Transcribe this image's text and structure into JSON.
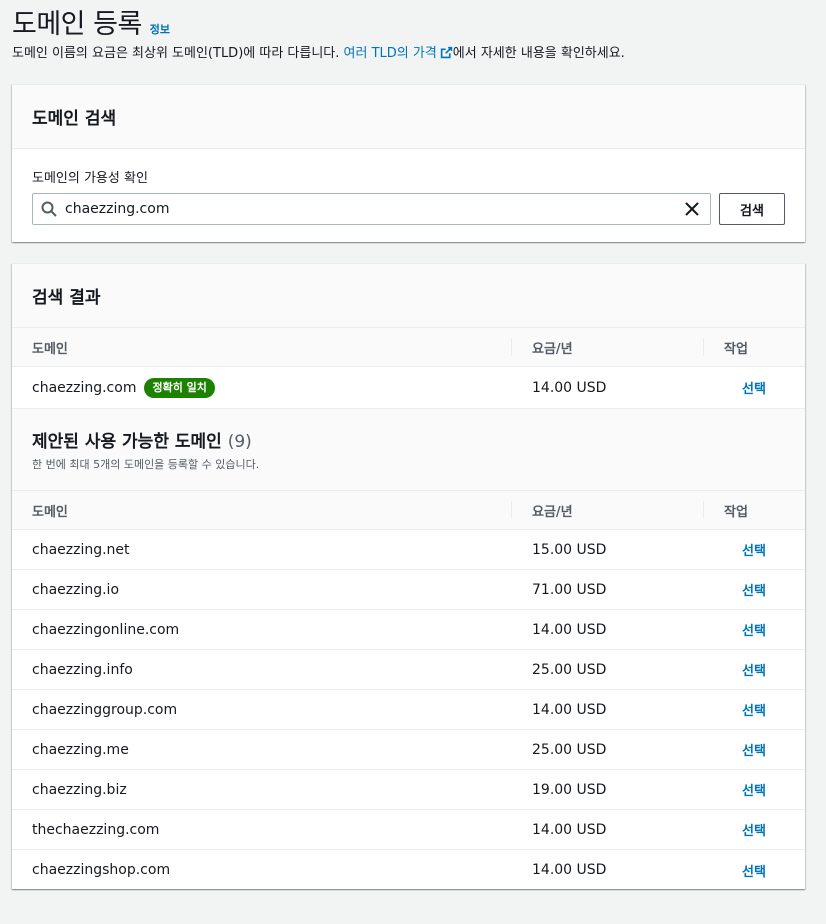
{
  "header": {
    "title": "도메인 등록",
    "info": "정보",
    "desc_prefix": "도메인 이름의 요금은 최상위 도메인(TLD)에 따라 다릅니다. ",
    "desc_link": "여러 TLD의 가격",
    "desc_suffix": "에서 자세한 내용을 확인하세요."
  },
  "search": {
    "title": "도메인 검색",
    "label": "도메인의 가용성 확인",
    "value": "chaezzing.com",
    "button": "검색"
  },
  "results": {
    "title": "검색 결과",
    "columns": {
      "domain": "도메인",
      "price": "요금/년",
      "action": "작업"
    },
    "exact": {
      "domain": "chaezzing.com",
      "badge": "정확히 일치",
      "price": "14.00 USD",
      "action": "선택"
    },
    "suggested": {
      "title": "제안된 사용 가능한 도메인",
      "count": "(9)",
      "desc": "한 번에 최대 5개의 도메인을 등록할 수 있습니다.",
      "rows": [
        {
          "domain": "chaezzing.net",
          "price": "15.00 USD",
          "action": "선택"
        },
        {
          "domain": "chaezzing.io",
          "price": "71.00 USD",
          "action": "선택"
        },
        {
          "domain": "chaezzingonline.com",
          "price": "14.00 USD",
          "action": "선택"
        },
        {
          "domain": "chaezzing.info",
          "price": "25.00 USD",
          "action": "선택"
        },
        {
          "domain": "chaezzinggroup.com",
          "price": "14.00 USD",
          "action": "선택"
        },
        {
          "domain": "chaezzing.me",
          "price": "25.00 USD",
          "action": "선택"
        },
        {
          "domain": "chaezzing.biz",
          "price": "19.00 USD",
          "action": "선택"
        },
        {
          "domain": "thechaezzing.com",
          "price": "14.00 USD",
          "action": "선택"
        },
        {
          "domain": "chaezzingshop.com",
          "price": "14.00 USD",
          "action": "선택"
        }
      ]
    }
  },
  "icons": {
    "info_link": "external-link-icon",
    "search": "search-icon",
    "clear": "close-icon"
  },
  "colors": {
    "link": "#0073bb",
    "badge_bg": "#1d8102",
    "page_bg": "#f2f3f3"
  }
}
